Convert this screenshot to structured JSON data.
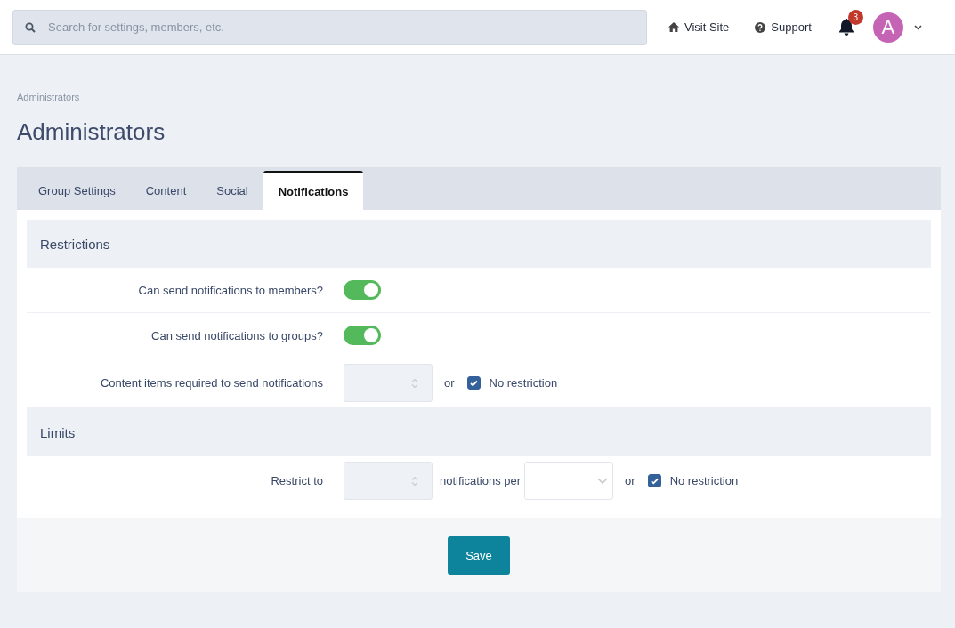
{
  "search": {
    "placeholder": "Search for settings, members, etc."
  },
  "header_links": [
    {
      "kind": "home",
      "label": "Visit Site"
    },
    {
      "kind": "help",
      "label": "Support"
    }
  ],
  "notifications": {
    "count": "3"
  },
  "user": {
    "initial": "A"
  },
  "breadcrumb": "Administrators",
  "title": "Administrators",
  "tabs": [
    {
      "label": "Group Settings",
      "selected": false
    },
    {
      "label": "Content",
      "selected": false
    },
    {
      "label": "Social",
      "selected": false
    },
    {
      "label": "Notifications",
      "selected": true
    }
  ],
  "sections": [
    {
      "title": "Restrictions",
      "rows": [
        {
          "kind": "toggle",
          "label": "Can send notifications to members?",
          "on": true
        },
        {
          "kind": "toggle",
          "label": "Can send notifications to groups?",
          "on": true
        },
        {
          "kind": "number",
          "label": "Content items required to send notifications",
          "connector": "or",
          "checkbox": {
            "label": "No restriction",
            "checked": true
          }
        }
      ]
    },
    {
      "title": "Limits",
      "rows": [
        {
          "kind": "limit",
          "label": "Restrict to",
          "between": "notifications per",
          "connector": "or",
          "checkbox": {
            "label": "No restriction",
            "checked": true
          }
        }
      ]
    }
  ],
  "save_button": "Save"
}
